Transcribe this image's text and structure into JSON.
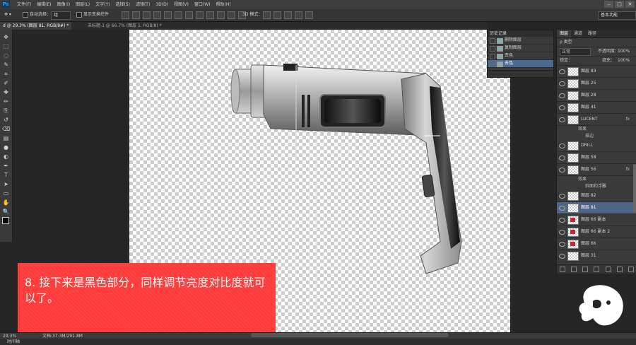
{
  "app": {
    "logo": "Ps",
    "menu": [
      "文件(F)",
      "编辑(E)",
      "图像(I)",
      "图层(L)",
      "文字(Y)",
      "选择(S)",
      "滤镜(T)",
      "3D(D)",
      "视图(V)",
      "窗口(W)",
      "帮助(H)"
    ],
    "window_controls": [
      "‒",
      "□",
      "✕"
    ]
  },
  "options": {
    "auto_select_label": "自动选择：",
    "auto_select_value": "组",
    "show_transform_label": "显示变换控件",
    "mode_3d_label": "3D 模式：",
    "workspace": "基本功能"
  },
  "tabs": [
    {
      "label": "d @ 29.3% (图层 81, RGB/8#) *",
      "active": true
    },
    {
      "label": "未标题-1 @ 66.7% (图层 1, RGB/8) *",
      "active": false
    }
  ],
  "toolbox": {
    "tools": [
      "move-tool",
      "marquee-tool",
      "lasso-tool",
      "quick-select-tool",
      "crop-tool",
      "eyedropper-tool",
      "healing-tool",
      "brush-tool",
      "clone-tool",
      "history-brush-tool",
      "eraser-tool",
      "gradient-tool",
      "blur-tool",
      "dodge-tool",
      "pen-tool",
      "type-tool",
      "path-select-tool",
      "shape-tool",
      "hand-tool",
      "zoom-tool"
    ],
    "glyphs": [
      "✥",
      "⬚",
      "◌",
      "✎",
      "⌗",
      "✐",
      "✚",
      "✏",
      "⎘",
      "↺",
      "⌫",
      "▤",
      "●",
      "◐",
      "✒",
      "T",
      "➤",
      "▭",
      "✋",
      "🔍"
    ]
  },
  "history": {
    "title": "历史记录",
    "items": [
      {
        "label": "删除图层",
        "selected": false
      },
      {
        "label": "复制图层",
        "selected": false
      },
      {
        "label": "去色",
        "selected": false
      },
      {
        "label": "去色",
        "selected": true
      }
    ]
  },
  "layers": {
    "tabs": [
      "图层",
      "通道",
      "路径"
    ],
    "filter_kind": "ρ 类型",
    "blend_mode": "正常",
    "opacity_label": "不透明度：",
    "opacity_value": "100%",
    "lock_label": "锁定：",
    "fill_label": "填充：",
    "fill_value": "100%",
    "rows": [
      {
        "name": "图层 83",
        "kind": "layer"
      },
      {
        "name": "图层 25",
        "kind": "layer"
      },
      {
        "name": "图层 28",
        "kind": "layer"
      },
      {
        "name": "图层 41",
        "kind": "layer"
      },
      {
        "name": "LUCENT",
        "kind": "layer",
        "fx": "fx"
      },
      {
        "name": "效果",
        "kind": "sub"
      },
      {
        "name": "描边",
        "kind": "sub2"
      },
      {
        "name": "DRILL",
        "kind": "layer"
      },
      {
        "name": "图层 58",
        "kind": "layer"
      },
      {
        "name": "图层 56",
        "kind": "layer",
        "fx": "fx"
      },
      {
        "name": "效果",
        "kind": "sub"
      },
      {
        "name": "斜面和浮雕",
        "kind": "sub2"
      },
      {
        "name": "图层 82",
        "kind": "layer"
      },
      {
        "name": "图层 81",
        "kind": "layer",
        "selected": true
      },
      {
        "name": "图层 66 副本",
        "kind": "layer",
        "red": true
      },
      {
        "name": "图层 66 副本 2",
        "kind": "layer",
        "red": true
      },
      {
        "name": "图层 66",
        "kind": "layer",
        "red": true
      },
      {
        "name": "图层 31",
        "kind": "layer"
      }
    ]
  },
  "caption": {
    "text": "8. 接下来是黑色部分，同样调节亮度对比度就可以了。"
  },
  "status": {
    "zoom": "29.3%",
    "doc": "文档:37.3M/291.8M",
    "timeline": "时间轴"
  },
  "colors": {
    "accent": "#4b6a8f",
    "caption_bg": "#ff3b3b",
    "canvas_check": "#cccccc"
  }
}
